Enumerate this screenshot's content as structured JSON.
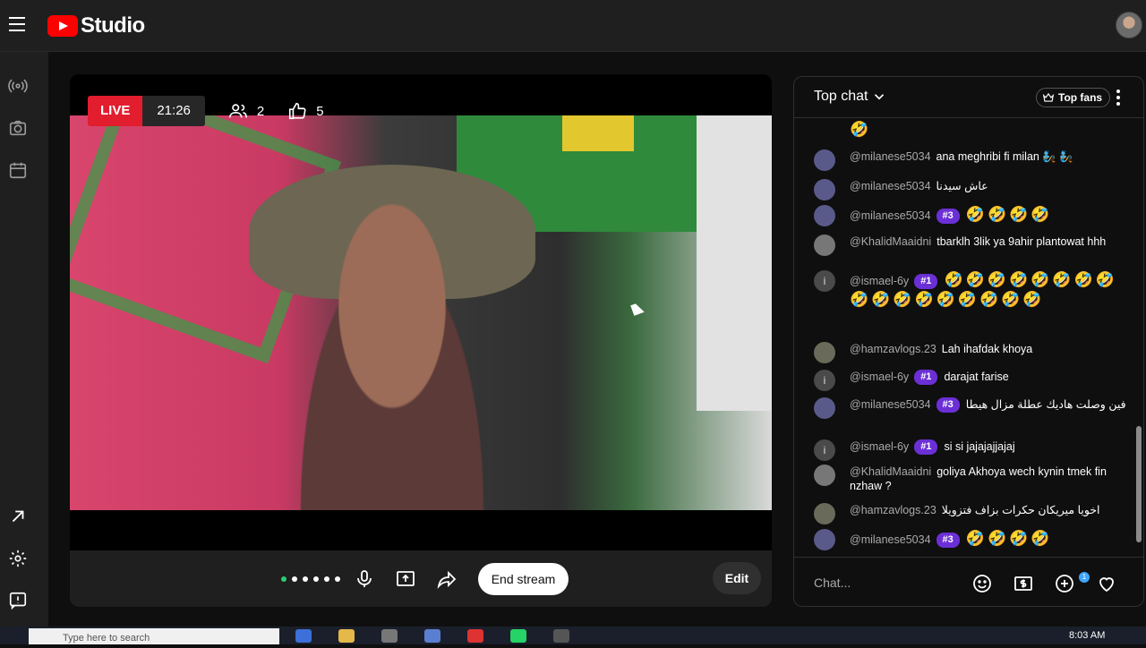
{
  "app": {
    "brand": "Studio"
  },
  "stream": {
    "live_label": "LIVE",
    "elapsed": "21:26",
    "viewers": "2",
    "likes": "5"
  },
  "controls": {
    "end_stream": "End stream",
    "edit": "Edit"
  },
  "chat": {
    "title": "Top chat",
    "top_fans": "Top fans",
    "input_placeholder": "Chat...",
    "notif_count": "1",
    "messages": [
      {
        "author": "@milanese5034",
        "badge": "",
        "text": "ana meghribi fi milan 🧞 🧞"
      },
      {
        "author": "@milanese5034",
        "badge": "",
        "text": "عاش سيدنا"
      },
      {
        "author": "@milanese5034",
        "badge": "#3",
        "text": "🤣🤣🤣🤣"
      },
      {
        "author": "@KhalidMaaidni",
        "badge": "",
        "text": "tbarklh 3lik ya 9ahir plantowat hhh"
      },
      {
        "author": "@ismael-6y",
        "badge": "#1",
        "text": "🤣🤣🤣🤣🤣🤣🤣🤣🤣🤣🤣🤣🤣🤣🤣🤣🤣"
      },
      {
        "author": "@hamzavlogs.23",
        "badge": "",
        "text": "Lah ihafdak khoya"
      },
      {
        "author": "@ismael-6y",
        "badge": "#1",
        "text": "darajat farise"
      },
      {
        "author": "@milanese5034",
        "badge": "#3",
        "text": "فين وصلت هاديك عطلة مزال هيطا"
      },
      {
        "author": "@ismael-6y",
        "badge": "#1",
        "text": "si si jajajajjajaj"
      },
      {
        "author": "@KhalidMaaidni",
        "badge": "",
        "text": "goliya Akhoya wech kynin tmek fin nzhaw ?"
      },
      {
        "author": "@hamzavlogs.23",
        "badge": "",
        "text": "اخويا ميريكان حكرات بزاف فتزويلا"
      },
      {
        "author": "@milanese5034",
        "badge": "#3",
        "text": "🤣🤣🤣🤣"
      }
    ]
  },
  "taskbar": {
    "search_placeholder": "Type here to search",
    "time": "8:03 AM"
  },
  "colors": {
    "live": "#e11d2e",
    "badge": "#6b2fd6",
    "accent": "#3ea6ff"
  }
}
